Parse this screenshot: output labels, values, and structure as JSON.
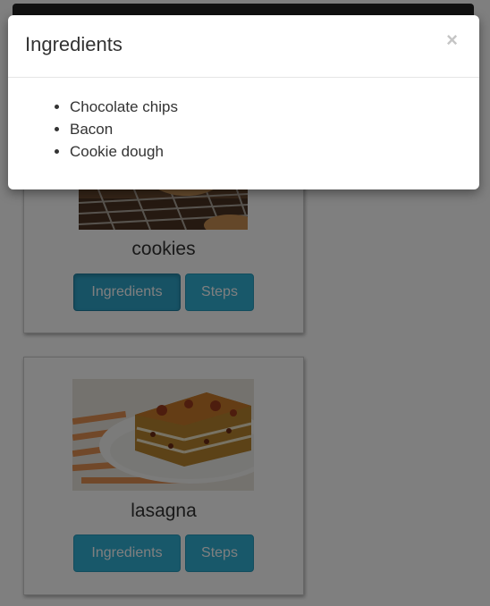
{
  "modal": {
    "title": "Ingredients",
    "close_label": "×",
    "ingredients": [
      "Chocolate chips",
      "Bacon",
      "Cookie dough"
    ]
  },
  "recipes": [
    {
      "name": "cookies",
      "ingredients_label": "Ingredients",
      "steps_label": "Steps",
      "image": "cookies-photo"
    },
    {
      "name": "lasagna",
      "ingredients_label": "Ingredients",
      "steps_label": "Steps",
      "image": "lasagna-photo"
    }
  ],
  "colors": {
    "button": "#31b0d5",
    "navbar": "#222222",
    "backdrop": "rgba(0,0,0,0.5)"
  }
}
